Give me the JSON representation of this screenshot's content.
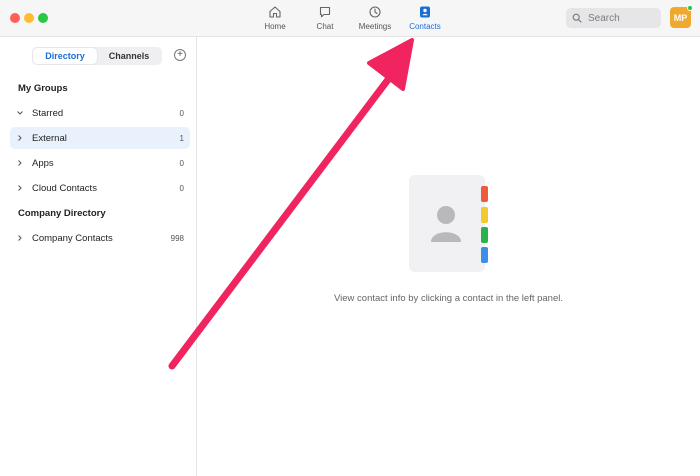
{
  "colors": {
    "accent": "#1a6fd6",
    "arrow": "#f0245e",
    "tab_red": "#f05a3c",
    "tab_yellow": "#f3c92b",
    "tab_green": "#27b24a",
    "tab_blue": "#3b8fe6"
  },
  "nav": {
    "items": [
      {
        "label": "Home",
        "icon": "home-icon"
      },
      {
        "label": "Chat",
        "icon": "chat-icon"
      },
      {
        "label": "Meetings",
        "icon": "clock-icon"
      },
      {
        "label": "Contacts",
        "icon": "contacts-icon",
        "active": true
      }
    ]
  },
  "search": {
    "placeholder": "Search"
  },
  "user": {
    "initials": "MP",
    "status": "online"
  },
  "sidebar": {
    "tabs": [
      {
        "label": "Directory",
        "active": true
      },
      {
        "label": "Channels",
        "active": false
      }
    ],
    "my_groups_title": "My Groups",
    "groups": [
      {
        "label": "Starred",
        "count": "0",
        "expanded": true
      },
      {
        "label": "External",
        "count": "1",
        "selected": true
      },
      {
        "label": "Apps",
        "count": "0"
      },
      {
        "label": "Cloud Contacts",
        "count": "0"
      }
    ],
    "company_title": "Company Directory",
    "company": [
      {
        "label": "Company Contacts",
        "count": "998"
      }
    ]
  },
  "main": {
    "empty_message": "View contact info by clicking a contact in the left panel."
  }
}
